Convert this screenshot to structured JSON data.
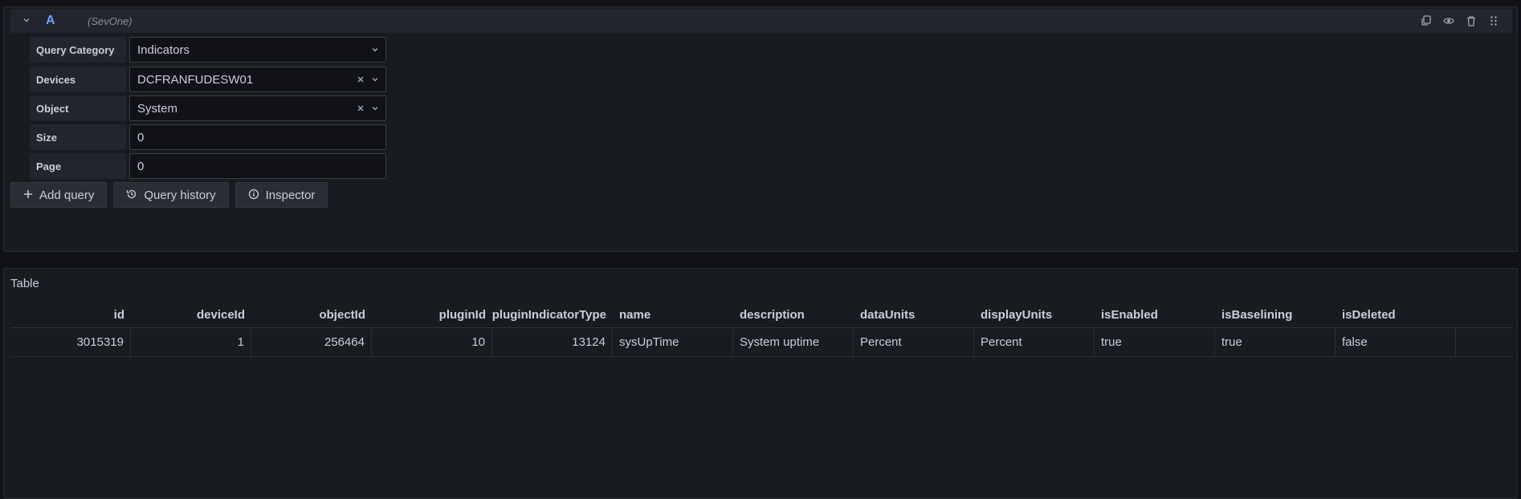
{
  "query": {
    "ref_id": "A",
    "datasource": "(SevOne)",
    "fields": [
      {
        "label": "Query Category",
        "value": "Indicators",
        "clearable": false
      },
      {
        "label": "Devices",
        "value": "DCFRANFUDESW01",
        "clearable": true
      },
      {
        "label": "Object",
        "value": "System",
        "clearable": true
      },
      {
        "label": "Size",
        "value": "0"
      },
      {
        "label": "Page",
        "value": "0"
      }
    ],
    "buttons": {
      "add_query": "Add query",
      "query_history": "Query history",
      "inspector": "Inspector"
    }
  },
  "panel": {
    "title": "Table",
    "columns": [
      "id",
      "deviceId",
      "objectId",
      "pluginId",
      "pluginIndicatorType",
      "name",
      "description",
      "dataUnits",
      "displayUnits",
      "isEnabled",
      "isBaselining",
      "isDeleted"
    ],
    "rows": [
      [
        "3015319",
        "1",
        "256464",
        "10",
        "13124",
        "sysUpTime",
        "System uptime",
        "Percent",
        "Percent",
        "true",
        "true",
        "false"
      ]
    ]
  },
  "icons": [
    "chevron-down-icon",
    "copy-icon",
    "eye-icon",
    "trash-icon",
    "drag-handle-icon",
    "plus-icon",
    "history-icon",
    "info-icon",
    "close-icon"
  ]
}
